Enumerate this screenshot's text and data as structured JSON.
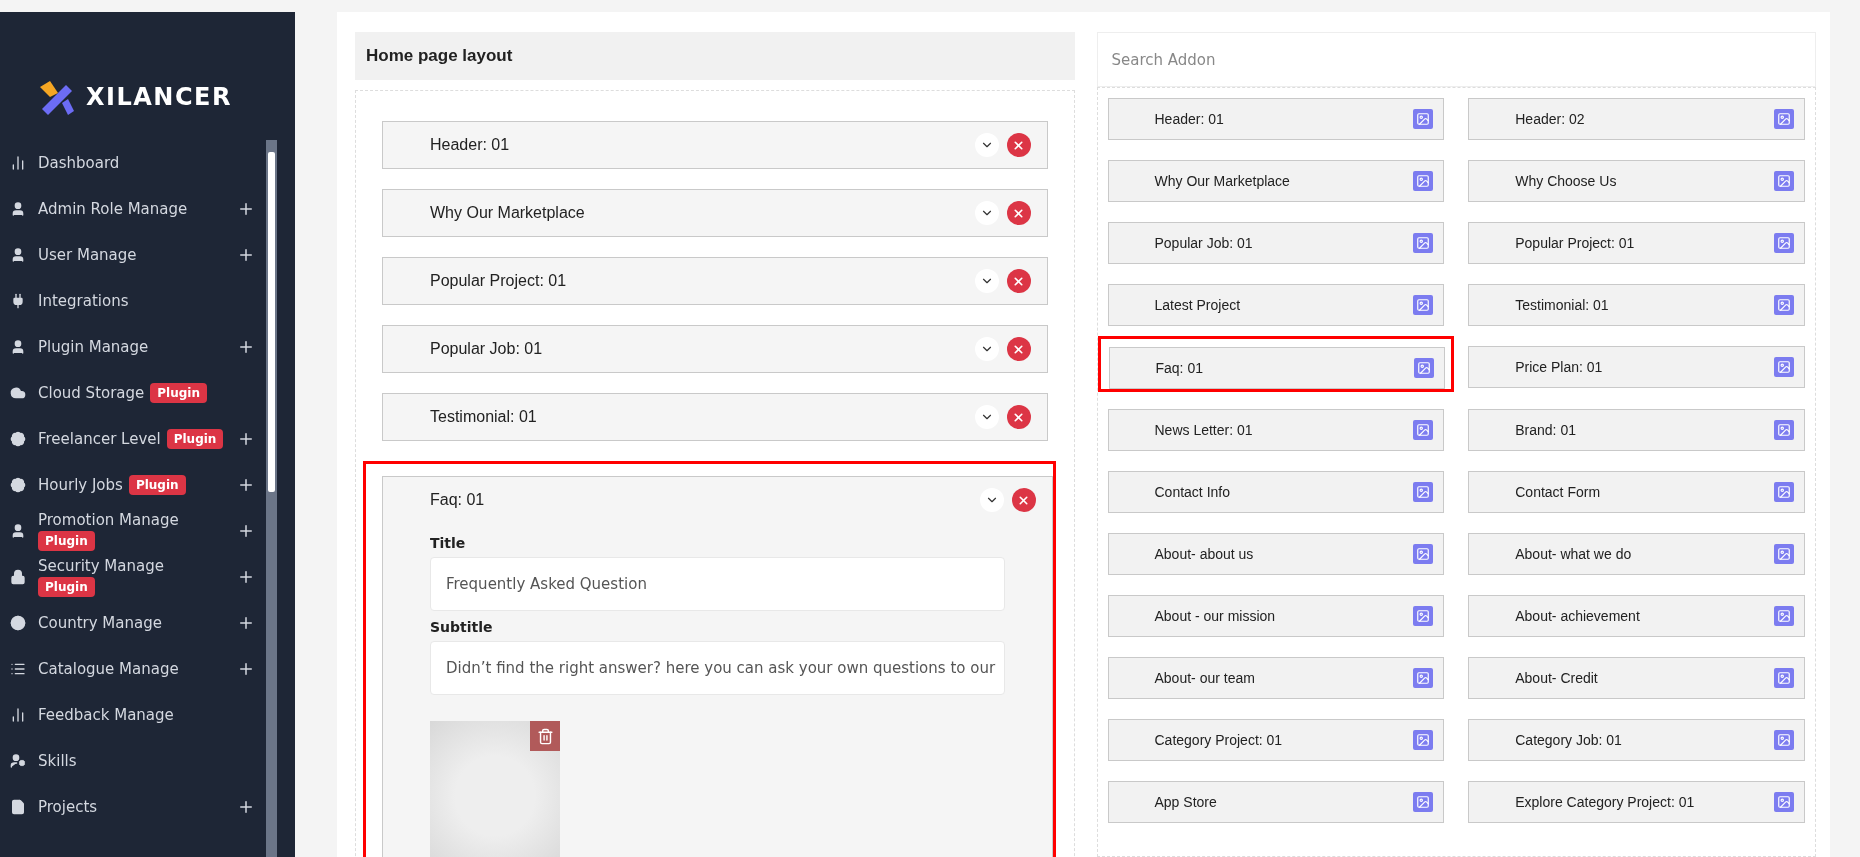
{
  "brand": {
    "name": "XILANCER"
  },
  "sidebar": {
    "items": [
      {
        "label": "Dashboard",
        "expandable": false
      },
      {
        "label": "Admin Role Manage",
        "expandable": true
      },
      {
        "label": "User Manage",
        "expandable": true
      },
      {
        "label": "Integrations",
        "expandable": false
      },
      {
        "label": "Plugin Manage",
        "expandable": true
      },
      {
        "label": "Cloud Storage",
        "expandable": false,
        "badge": "Plugin"
      },
      {
        "label": "Freelancer Level",
        "expandable": true,
        "badge": "Plugin"
      },
      {
        "label": "Hourly Jobs",
        "expandable": true,
        "badge": "Plugin"
      },
      {
        "label": "Promotion Manage",
        "expandable": true,
        "badge": "Plugin"
      },
      {
        "label": "Security Manage",
        "expandable": true,
        "badge": "Plugin"
      },
      {
        "label": "Country Manage",
        "expandable": true
      },
      {
        "label": "Catalogue Manage",
        "expandable": true
      },
      {
        "label": "Feedback Manage",
        "expandable": false
      },
      {
        "label": "Skills",
        "expandable": false
      },
      {
        "label": "Projects",
        "expandable": true
      }
    ]
  },
  "layout": {
    "title": "Home page layout",
    "items": [
      {
        "label": "Header: 01",
        "expanded": false,
        "highlighted": false
      },
      {
        "label": "Why Our Marketplace",
        "expanded": false,
        "highlighted": false
      },
      {
        "label": "Popular Project: 01",
        "expanded": false,
        "highlighted": false
      },
      {
        "label": "Popular Job: 01",
        "expanded": false,
        "highlighted": false
      },
      {
        "label": "Testimonial: 01",
        "expanded": false,
        "highlighted": false
      },
      {
        "label": "Faq: 01",
        "expanded": true,
        "highlighted": true,
        "fields": [
          {
            "label": "Title",
            "value": "Frequently Asked Question"
          },
          {
            "label": "Subtitle",
            "value": "Didn’t find the right answer? here you can ask your own questions to our"
          }
        ]
      }
    ]
  },
  "addons": {
    "search": {
      "placeholder": "Search Addon"
    },
    "items": [
      {
        "label": "Header: 01",
        "highlighted": false
      },
      {
        "label": "Header: 02",
        "highlighted": false
      },
      {
        "label": "Why Our Marketplace",
        "highlighted": false
      },
      {
        "label": "Why Choose Us",
        "highlighted": false
      },
      {
        "label": "Popular Job: 01",
        "highlighted": false
      },
      {
        "label": "Popular Project: 01",
        "highlighted": false
      },
      {
        "label": "Latest Project",
        "highlighted": false
      },
      {
        "label": "Testimonial: 01",
        "highlighted": false
      },
      {
        "label": "Faq: 01",
        "highlighted": true
      },
      {
        "label": "Price Plan: 01",
        "highlighted": false
      },
      {
        "label": "News Letter: 01",
        "highlighted": false
      },
      {
        "label": "Brand: 01",
        "highlighted": false
      },
      {
        "label": "Contact Info",
        "highlighted": false
      },
      {
        "label": "Contact Form",
        "highlighted": false
      },
      {
        "label": "About- about us",
        "highlighted": false
      },
      {
        "label": "About- what we do",
        "highlighted": false
      },
      {
        "label": "About - our mission",
        "highlighted": false
      },
      {
        "label": "About- achievement",
        "highlighted": false
      },
      {
        "label": "About- our team",
        "highlighted": false
      },
      {
        "label": "About- Credit",
        "highlighted": false
      },
      {
        "label": "Category Project: 01",
        "highlighted": false
      },
      {
        "label": "Category Job: 01",
        "highlighted": false
      },
      {
        "label": "App Store",
        "highlighted": false
      },
      {
        "label": "Explore Category Project: 01",
        "highlighted": false
      }
    ]
  }
}
